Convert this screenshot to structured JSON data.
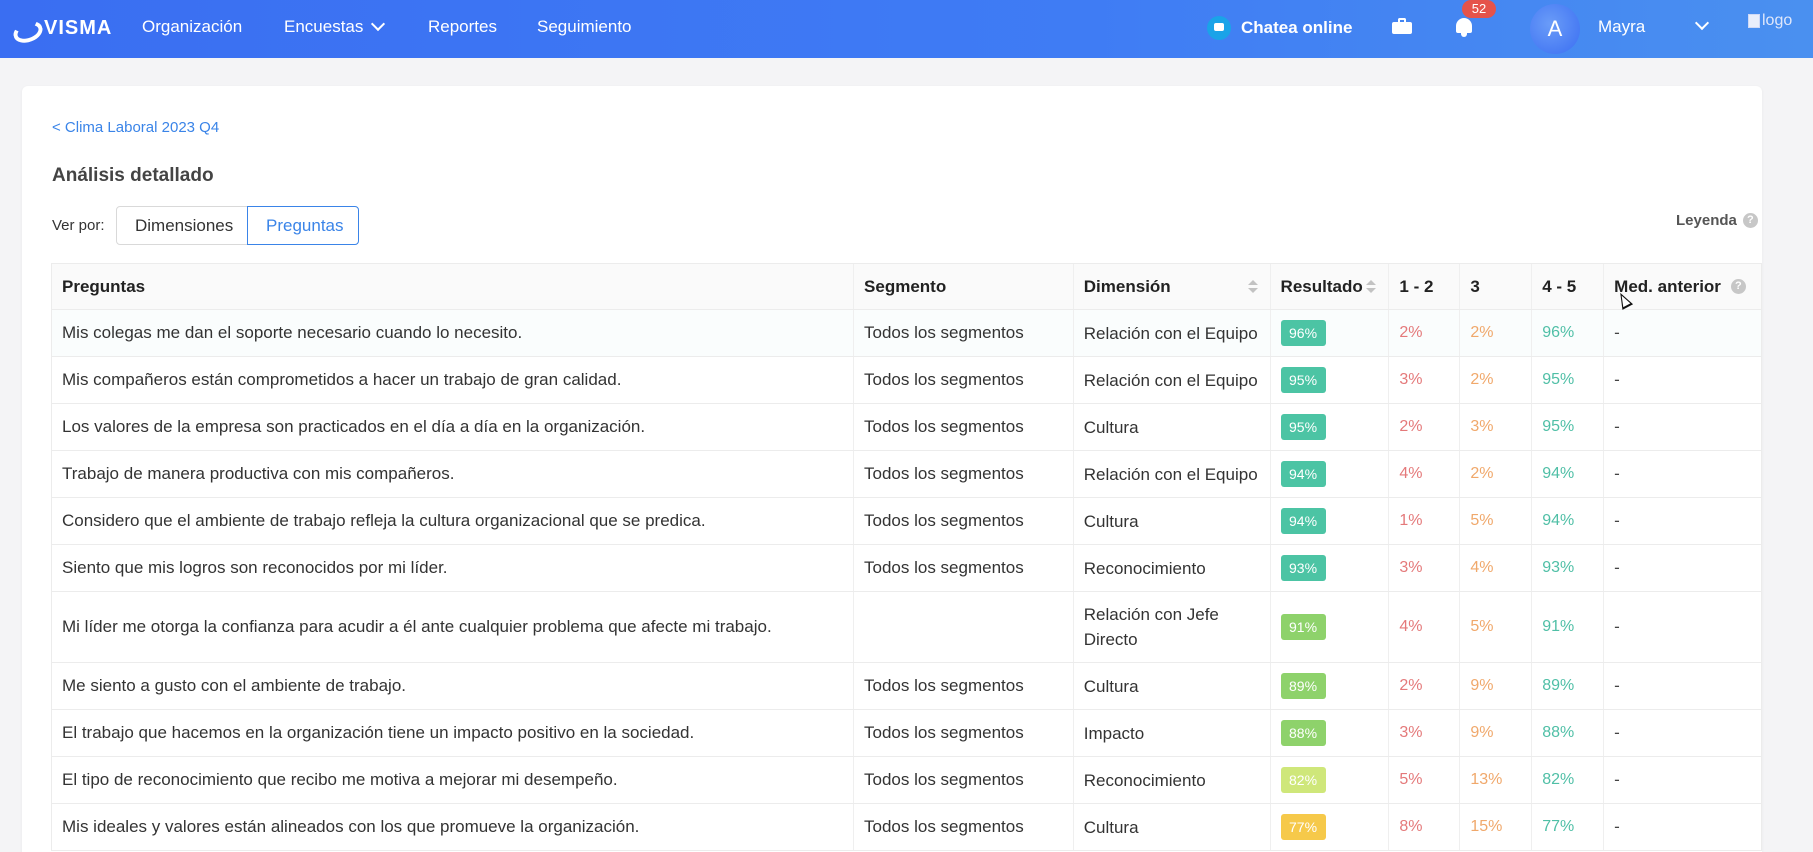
{
  "app": {
    "brand": "VISMA"
  },
  "nav": {
    "items": [
      {
        "label": "Organización"
      },
      {
        "label": "Encuestas"
      },
      {
        "label": "Reportes"
      },
      {
        "label": "Seguimiento"
      }
    ],
    "chat_label": "Chatea online",
    "notification_count": "52",
    "avatar_initial": "A",
    "user_name": "Mayra",
    "logo_alt": "logo"
  },
  "page": {
    "breadcrumb": "< Clima Laboral 2023 Q4",
    "title": "Análisis detallado",
    "view_by_label": "Ver por:",
    "toggle": {
      "option1": "Dimensiones",
      "option2": "Preguntas",
      "selected": "Preguntas"
    },
    "legend_label": "Leyenda",
    "help_glyph": "?"
  },
  "table": {
    "headers": {
      "pregunta": "Preguntas",
      "segmento": "Segmento",
      "dimension": "Dimensión",
      "resultado": "Resultado",
      "r12": "1 - 2",
      "r3": "3",
      "r45": "4 - 5",
      "anterior": "Med. anterior"
    },
    "rows": [
      {
        "pregunta": "Mis colegas me dan el soporte necesario cuando lo necesito.",
        "segmento": "Todos los segmentos",
        "dimension": "Relación con el Equipo",
        "resultado": "96%",
        "color": "#4cc4a4",
        "r12": "2%",
        "r3": "2%",
        "r45": "96%",
        "anterior": "-"
      },
      {
        "pregunta": "Mis compañeros están comprometidos a hacer un trabajo de gran calidad.",
        "segmento": "Todos los segmentos",
        "dimension": "Relación con el Equipo",
        "resultado": "95%",
        "color": "#4cc4a4",
        "r12": "3%",
        "r3": "2%",
        "r45": "95%",
        "anterior": "-"
      },
      {
        "pregunta": "Los valores de la empresa son practicados en el día a día en la organización.",
        "segmento": "Todos los segmentos",
        "dimension": "Cultura",
        "resultado": "95%",
        "color": "#4cc4a4",
        "r12": "2%",
        "r3": "3%",
        "r45": "95%",
        "anterior": "-"
      },
      {
        "pregunta": "Trabajo de manera productiva con mis compañeros.",
        "segmento": "Todos los segmentos",
        "dimension": "Relación con el Equipo",
        "resultado": "94%",
        "color": "#4cc4a4",
        "r12": "4%",
        "r3": "2%",
        "r45": "94%",
        "anterior": "-"
      },
      {
        "pregunta": "Considero que el ambiente de trabajo refleja la cultura organizacional que se predica.",
        "segmento": "Todos los segmentos",
        "dimension": "Cultura",
        "resultado": "94%",
        "color": "#4cc4a4",
        "r12": "1%",
        "r3": "5%",
        "r45": "94%",
        "anterior": "-"
      },
      {
        "pregunta": "Siento que mis logros son reconocidos por mi líder.",
        "segmento": "Todos los segmentos",
        "dimension": "Reconocimiento",
        "resultado": "93%",
        "color": "#4cc4a4",
        "r12": "3%",
        "r3": "4%",
        "r45": "93%",
        "anterior": "-"
      },
      {
        "pregunta": "Mi líder me otorga la confianza para acudir a él ante cualquier problema que afecte mi trabajo.",
        "segmento": "",
        "dimension": "Relación con Jefe Directo",
        "resultado": "91%",
        "color": "#8ed26b",
        "r12": "4%",
        "r3": "5%",
        "r45": "91%",
        "anterior": "-"
      },
      {
        "pregunta": "Me siento a gusto con el ambiente de trabajo.",
        "segmento": "Todos los segmentos",
        "dimension": "Cultura",
        "resultado": "89%",
        "color": "#8ed26b",
        "r12": "2%",
        "r3": "9%",
        "r45": "89%",
        "anterior": "-"
      },
      {
        "pregunta": "El trabajo que hacemos en la organización tiene un impacto positivo en la sociedad.",
        "segmento": "Todos los segmentos",
        "dimension": "Impacto",
        "resultado": "88%",
        "color": "#8ed26b",
        "r12": "3%",
        "r3": "9%",
        "r45": "88%",
        "anterior": "-"
      },
      {
        "pregunta": "El tipo de reconocimiento que recibo me motiva a mejorar mi desempeño.",
        "segmento": "Todos los segmentos",
        "dimension": "Reconocimiento",
        "resultado": "82%",
        "color": "#cfe77a",
        "r12": "5%",
        "r3": "13%",
        "r45": "82%",
        "anterior": "-"
      },
      {
        "pregunta": "Mis ideales y valores están alineados con los que promueve la organización.",
        "segmento": "Todos los segmentos",
        "dimension": "Cultura",
        "resultado": "77%",
        "color": "#f6c94a",
        "r12": "8%",
        "r3": "15%",
        "r45": "77%",
        "anterior": "-"
      }
    ]
  }
}
